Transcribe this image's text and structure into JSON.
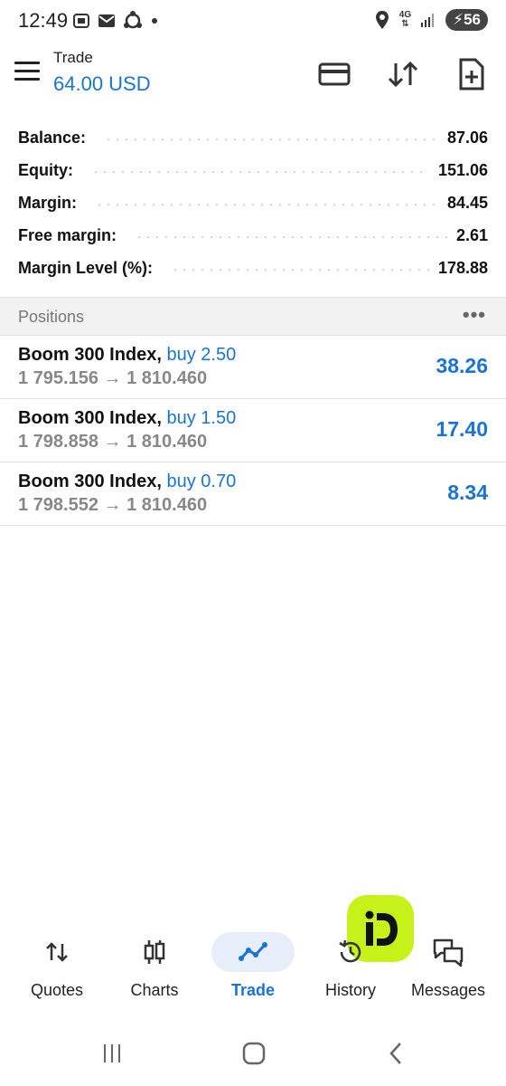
{
  "status_bar": {
    "time": "12:49",
    "network": "4G",
    "battery": "56",
    "icons_left": [
      "screenshot-icon",
      "mail-icon",
      "sync-icon",
      "dot-icon"
    ],
    "icons_right": [
      "location-icon",
      "signal-icon",
      "battery-icon"
    ]
  },
  "header": {
    "title": "Trade",
    "balance": "64.00 USD",
    "actions": [
      "card-icon",
      "sort-arrows-icon",
      "new-document-icon"
    ]
  },
  "summary": [
    {
      "label": "Balance:",
      "value": "87.06"
    },
    {
      "label": "Equity:",
      "value": "151.06"
    },
    {
      "label": "Margin:",
      "value": "84.45"
    },
    {
      "label": "Free margin:",
      "value": "2.61"
    },
    {
      "label": "Margin Level (%):",
      "value": "178.88"
    }
  ],
  "positions_section": {
    "title": "Positions",
    "more": "•••"
  },
  "positions": [
    {
      "symbol": "Boom 300 Index,",
      "side": "buy 2.50",
      "prices": "1 795.156 → 1 810.460",
      "profit": "38.26"
    },
    {
      "symbol": "Boom 300 Index,",
      "side": "buy 1.50",
      "prices": "1 798.858 → 1 810.460",
      "profit": "17.40"
    },
    {
      "symbol": "Boom 300 Index,",
      "side": "buy 0.70",
      "prices": "1 798.552 → 1 810.460",
      "profit": "8.34"
    }
  ],
  "bottom_nav": [
    {
      "label": "Quotes",
      "icon": "quotes-arrows-icon",
      "active": false
    },
    {
      "label": "Charts",
      "icon": "candlestick-icon",
      "active": false
    },
    {
      "label": "Trade",
      "icon": "trade-line-icon",
      "active": true
    },
    {
      "label": "History",
      "icon": "history-icon",
      "active": false
    },
    {
      "label": "Messages",
      "icon": "messages-icon",
      "active": false
    }
  ],
  "colors": {
    "accent": "#1a73d6",
    "fab": "#c6f21a",
    "active_pill": "#e6eefa"
  }
}
